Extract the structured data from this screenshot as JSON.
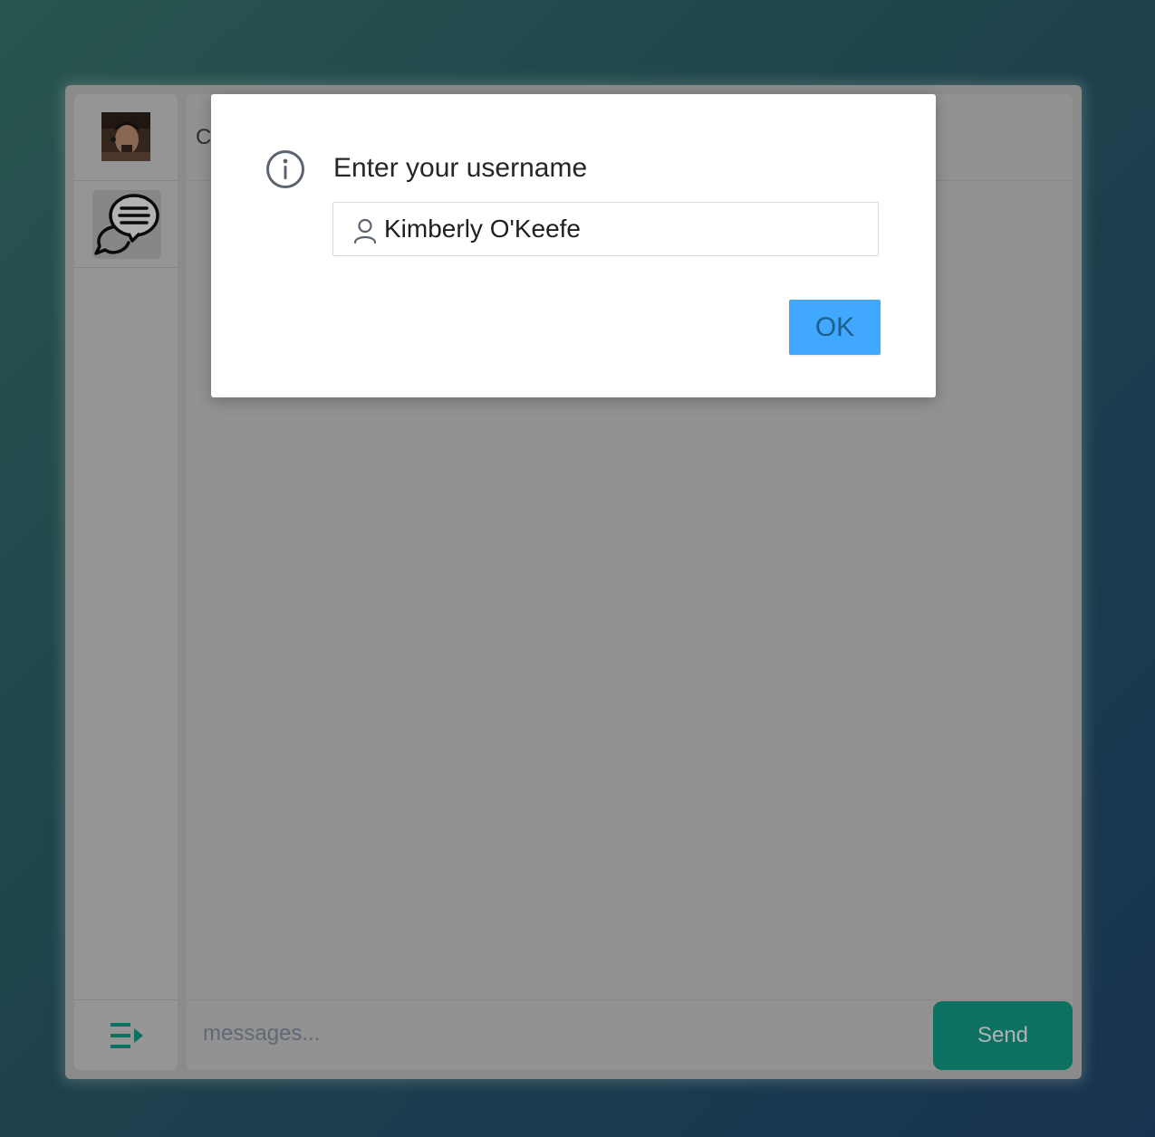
{
  "chat": {
    "title": "C",
    "message_placeholder": "messages...",
    "send_label": "Send"
  },
  "modal": {
    "title": "Enter your username",
    "username_value": "Kimberly O'Keefe",
    "ok_label": "OK"
  },
  "icons": {
    "avatar": "user-avatar-photo",
    "chat": "chat-bubbles-icon",
    "menu": "menu-collapse-icon",
    "info": "info-circle-icon",
    "user": "user-icon"
  },
  "colors": {
    "send_button": "#14a38c",
    "ok_button": "#40a9ff",
    "menu_icon": "#14a38c"
  }
}
